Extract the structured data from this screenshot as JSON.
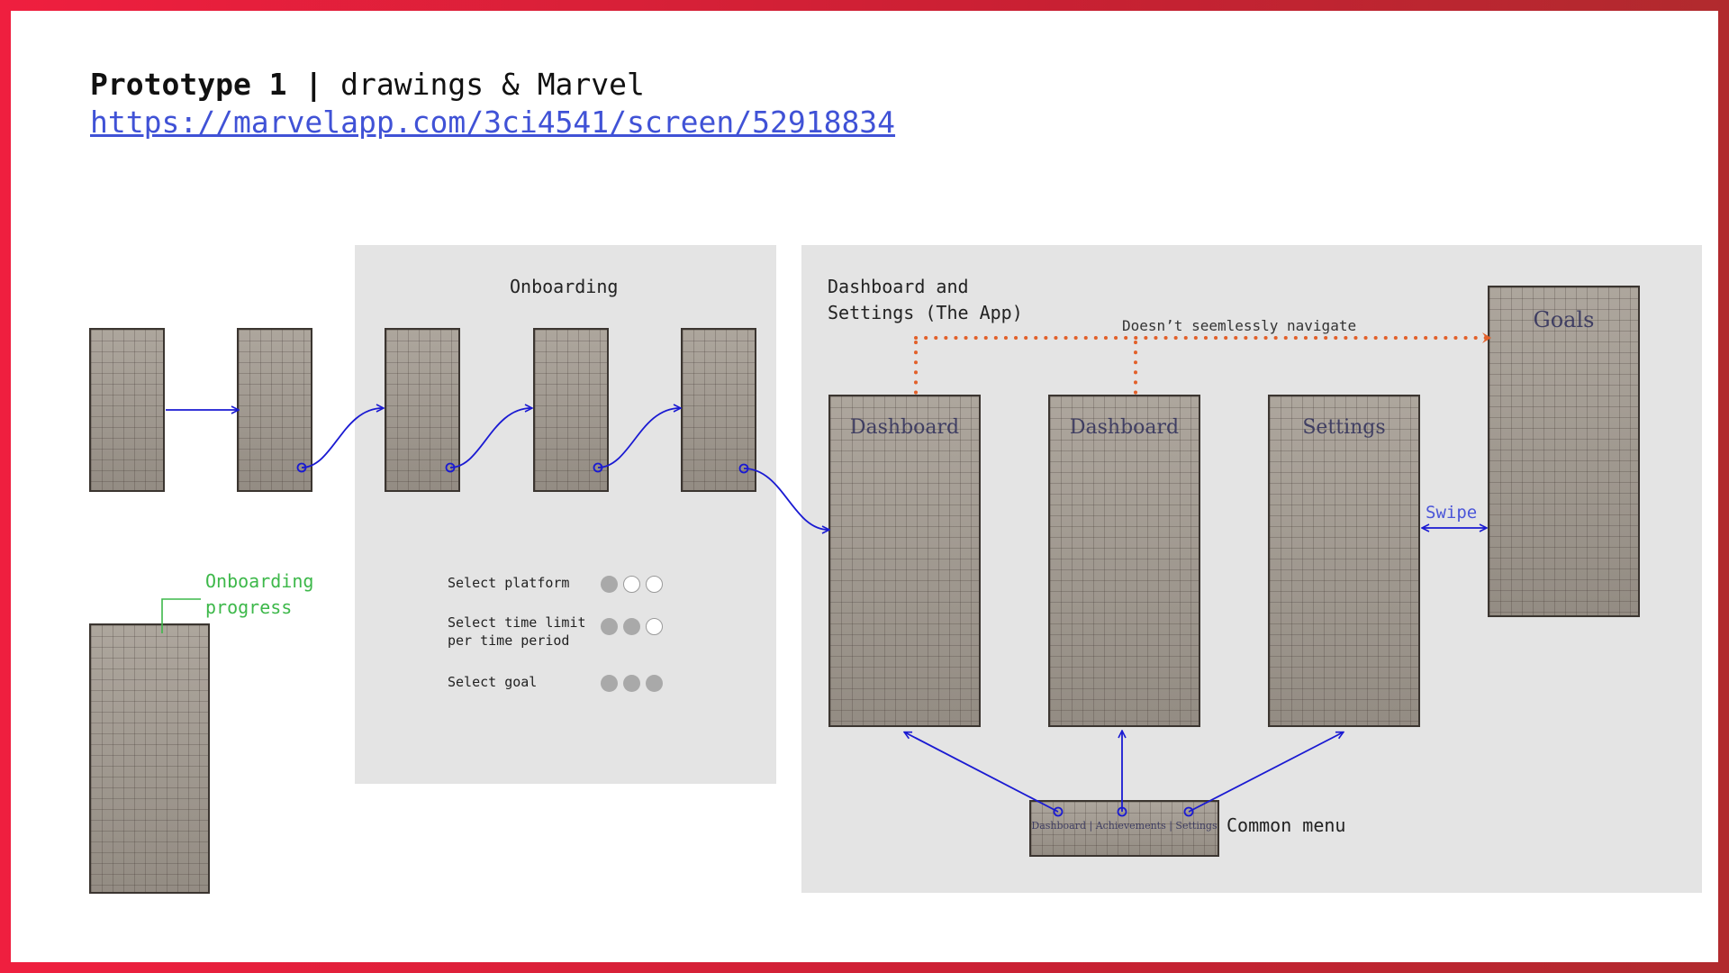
{
  "header": {
    "title_bold": "Prototype 1 |",
    "title_rest": " drawings & Marvel",
    "link": "https://marvelapp.com/3ci4541/screen/52918834"
  },
  "onboarding_panel": {
    "title": "Onboarding"
  },
  "app_panel": {
    "title_line1": "Dashboard and",
    "title_line2": "Settings (The App)"
  },
  "annotations": {
    "onboarding_progress_line1": "Onboarding",
    "onboarding_progress_line2": "progress",
    "no_navigation": "Doesn’t seemlessly navigate",
    "swipe": "Swipe",
    "common_menu": "Common menu"
  },
  "legend": [
    {
      "label": "Select platform",
      "dots": [
        true,
        false,
        false
      ]
    },
    {
      "label_line1": "Select time limit",
      "label_line2": "per time period",
      "dots": [
        true,
        true,
        false
      ]
    },
    {
      "label": "Select goal",
      "dots": [
        true,
        true,
        true
      ]
    }
  ],
  "sketch_labels": {
    "dashboard": "Dashboard",
    "achievements": "Dashboard",
    "settings": "Settings",
    "goals": "Goals",
    "menu": "Dashboard | Achievements | Settings"
  },
  "colors": {
    "flow_arrow": "#1a1ad2",
    "progress_callout": "#3db84a",
    "no_navigation": "#e2602a",
    "swipe": "#4a55d8"
  }
}
